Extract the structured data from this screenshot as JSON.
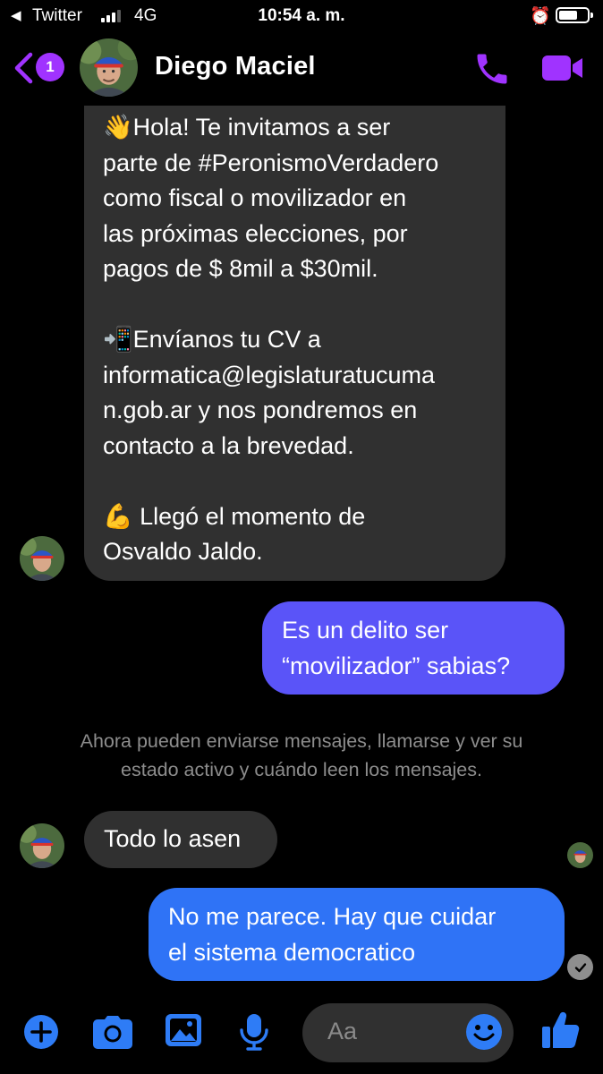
{
  "status_bar": {
    "back_app": "Twitter",
    "network": "4G",
    "time": "10:54 a. m."
  },
  "header": {
    "unread_badge": "1",
    "contact_name": "Diego Maciel",
    "icons": [
      "back-chevron-icon",
      "phone-icon",
      "video-camera-icon"
    ]
  },
  "messages": {
    "m1": {
      "lines": [
        "👋Hola! Te invitamos a ser",
        "parte de #PeronismoVerdadero",
        "como fiscal o movilizador en",
        "las próximas elecciones, por",
        "pagos de $ 8mil a $30mil.",
        "",
        "📲Envíanos tu CV a",
        "informatica@legislaturatucuma",
        "n.gob.ar y nos pondremos en",
        "contacto a la brevedad.",
        "",
        "💪 Llegó el momento de",
        "Osvaldo Jaldo."
      ]
    },
    "m2": {
      "line1": "Es un delito ser",
      "line2": "“movilizador” sabias?"
    },
    "system": {
      "line1": "Ahora pueden enviarse mensajes, llamarse y ver su",
      "line2": "estado activo y cuándo leen los mensajes."
    },
    "m3": {
      "text": "Todo lo asen"
    },
    "m4": {
      "line1": "No me parece. Hay que cuidar",
      "line2": "el sistema democratico"
    }
  },
  "composer": {
    "placeholder": "Aa",
    "icons": [
      "plus-icon",
      "camera-icon",
      "photo-icon",
      "microphone-icon",
      "emoji-icon",
      "thumbs-up-icon"
    ]
  },
  "colors": {
    "accent": "#a033ff",
    "incoming_bubble": "#303030",
    "outgoing_bubble_top": "#5a54f8",
    "outgoing_bubble_bottom": "#2f73f6",
    "composer_icon": "#2e7cf6"
  }
}
